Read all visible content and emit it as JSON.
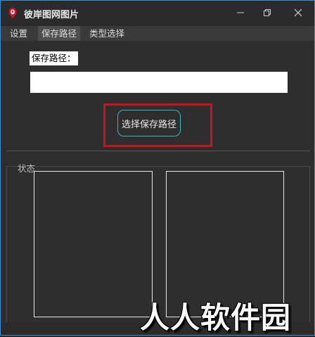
{
  "window": {
    "title": "彼岸图网图片"
  },
  "menu": {
    "items": [
      "设置",
      "保存路径",
      "类型选择"
    ],
    "active_index": 1
  },
  "save_path": {
    "label": "保存路径：",
    "value": "",
    "button_label": "选择保存路径"
  },
  "status": {
    "label": "状态"
  },
  "watermark": {
    "text": "人人软件园"
  },
  "colors": {
    "accent_border": "#3c8fd0",
    "highlight_red": "#d0101a",
    "button_border": "#37b6bf"
  }
}
